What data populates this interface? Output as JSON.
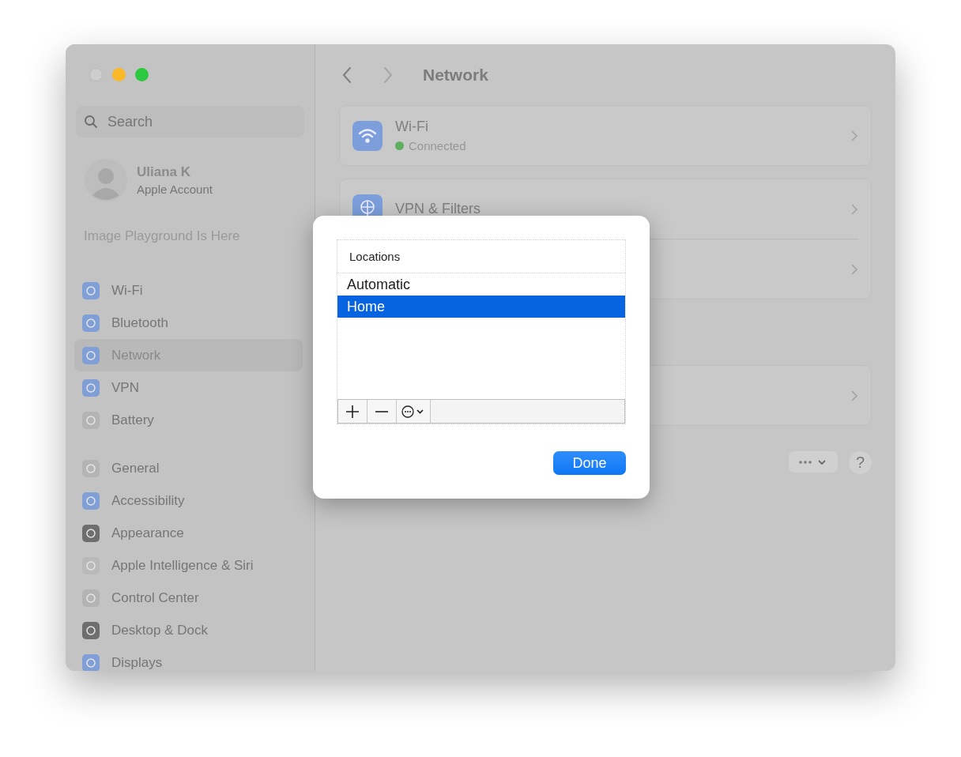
{
  "window": {
    "title": "Network"
  },
  "sidebar": {
    "search": {
      "placeholder": "Search"
    },
    "account": {
      "name": "Uliana K",
      "subtitle": "Apple Account"
    },
    "promo": "Image Playground Is Here",
    "groups": [
      {
        "items": [
          {
            "label": "Wi-Fi",
            "selected": false
          },
          {
            "label": "Bluetooth",
            "selected": false
          },
          {
            "label": "Network",
            "selected": true
          },
          {
            "label": "VPN",
            "selected": false
          },
          {
            "label": "Battery",
            "selected": false
          }
        ]
      },
      {
        "items": [
          {
            "label": "General",
            "selected": false
          },
          {
            "label": "Accessibility",
            "selected": false
          },
          {
            "label": "Appearance",
            "selected": false
          },
          {
            "label": "Apple Intelligence & Siri",
            "selected": false
          },
          {
            "label": "Control Center",
            "selected": false
          },
          {
            "label": "Desktop & Dock",
            "selected": false
          },
          {
            "label": "Displays",
            "selected": false
          }
        ]
      }
    ]
  },
  "services": [
    {
      "rows": [
        {
          "kind": "service",
          "title": "Wi-Fi",
          "status": "Connected",
          "color": "#5fae5f"
        }
      ]
    },
    {
      "rows": [
        {
          "kind": "service",
          "title": "VPN & Filters"
        },
        {
          "kind": "covered"
        }
      ]
    },
    {
      "rows": [
        {
          "kind": "covered"
        }
      ]
    }
  ],
  "footer": {
    "help": "?"
  },
  "dialog": {
    "header": "Locations",
    "locations": [
      {
        "label": "Automatic",
        "selected": false
      },
      {
        "label": "Home",
        "selected": true
      }
    ],
    "done": "Done"
  }
}
